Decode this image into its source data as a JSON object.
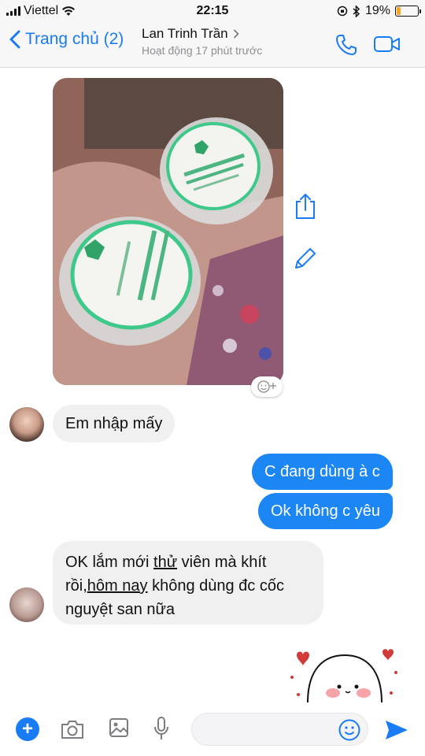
{
  "status_bar": {
    "carrier": "Viettel",
    "time": "22:15",
    "battery_percent": "19%",
    "battery_level": 0.19
  },
  "header": {
    "back_label": "Trang chủ (2)",
    "contact_name": "Lan Trinh Trần",
    "contact_status": "Hoạt động 17 phút trước"
  },
  "messages": [
    {
      "from": "them",
      "text": "Em nhập mấy"
    },
    {
      "from": "me",
      "text": "C đang dùng à c"
    },
    {
      "from": "me",
      "text": "Ok không c yêu"
    },
    {
      "from": "them",
      "line1_a": "OK lắm mới ",
      "line1_u": "thử",
      "line1_b": " viên mà khít",
      "line2_a": "rồi,",
      "line2_u": "hôm nay",
      "line2_b": " không dùng đc cốc",
      "line3": "nguyệt san nữa"
    }
  ],
  "colors": {
    "accent": "#1a7cf5",
    "outgoing_bubble": "#1d86f5",
    "incoming_bubble": "#f1f0f0",
    "status_text": "#8e8e93"
  },
  "icons": {
    "call": "phone-icon",
    "video": "video-camera-icon",
    "share": "share-icon",
    "edit": "pencil-icon",
    "plus": "plus-icon",
    "camera": "camera-icon",
    "image": "image-icon",
    "mic": "microphone-icon",
    "emoji": "emoji-icon",
    "send": "send-icon"
  }
}
